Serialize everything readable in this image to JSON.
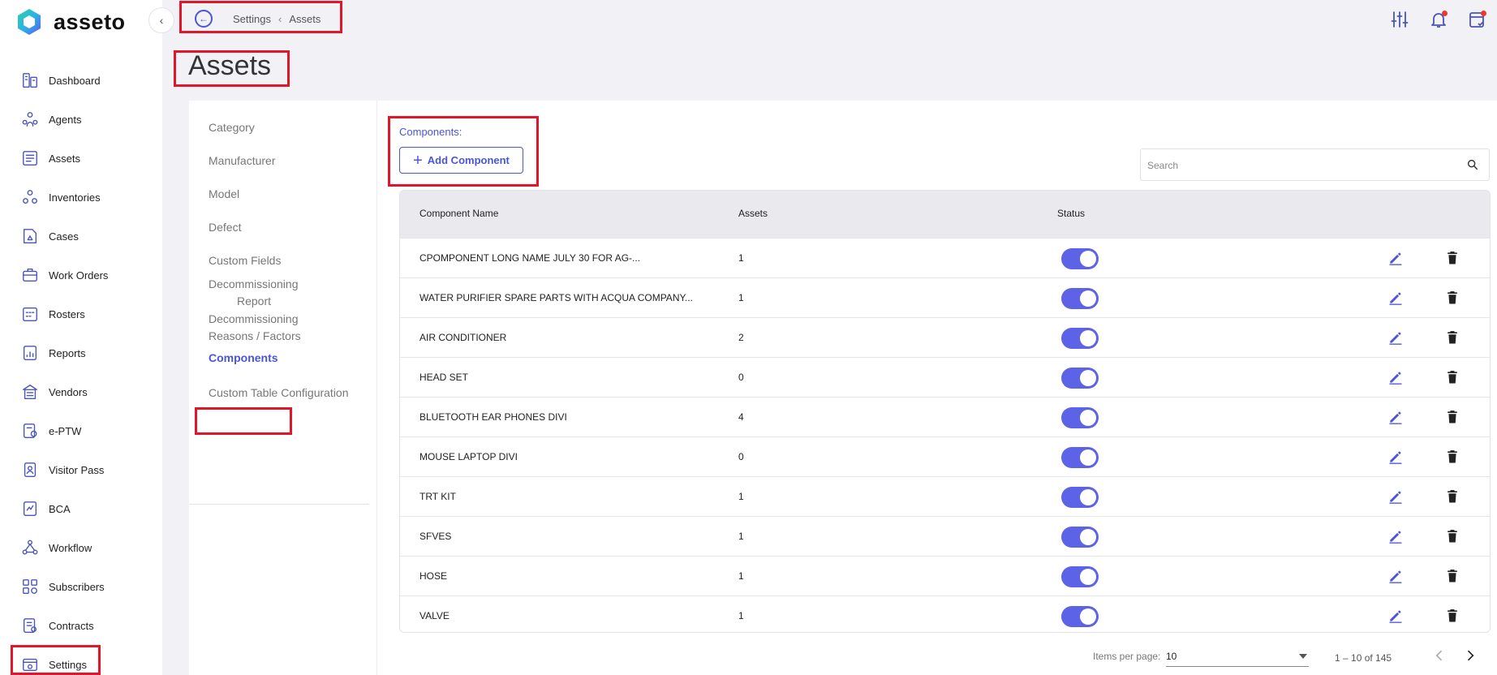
{
  "app": {
    "name": "asseto"
  },
  "sidebar": {
    "items": [
      {
        "label": "Dashboard",
        "icon": "dashboard-icon"
      },
      {
        "label": "Agents",
        "icon": "agents-icon"
      },
      {
        "label": "Assets",
        "icon": "assets-icon"
      },
      {
        "label": "Inventories",
        "icon": "inventories-icon"
      },
      {
        "label": "Cases",
        "icon": "cases-icon"
      },
      {
        "label": "Work Orders",
        "icon": "work-orders-icon"
      },
      {
        "label": "Rosters",
        "icon": "rosters-icon"
      },
      {
        "label": "Reports",
        "icon": "reports-icon"
      },
      {
        "label": "Vendors",
        "icon": "vendors-icon"
      },
      {
        "label": "e-PTW",
        "icon": "eptw-icon"
      },
      {
        "label": "Visitor Pass",
        "icon": "visitor-pass-icon"
      },
      {
        "label": "BCA",
        "icon": "bca-icon"
      },
      {
        "label": "Workflow",
        "icon": "workflow-icon"
      },
      {
        "label": "Subscribers",
        "icon": "subscribers-icon"
      },
      {
        "label": "Contracts",
        "icon": "contracts-icon"
      },
      {
        "label": "Settings",
        "icon": "settings-icon"
      }
    ]
  },
  "breadcrumb": {
    "parent": "Settings",
    "current": "Assets"
  },
  "page": {
    "title": "Assets"
  },
  "subnav": {
    "items": [
      {
        "label": "Category"
      },
      {
        "label": "Manufacturer"
      },
      {
        "label": "Model"
      },
      {
        "label": "Defect"
      },
      {
        "label": "Custom Fields"
      },
      {
        "label": "Decommissioning",
        "label2": "Report"
      },
      {
        "label": "Decommissioning",
        "label2": "Reasons / Factors"
      },
      {
        "label": "Components"
      },
      {
        "label": "Custom Table Configuration"
      }
    ],
    "active": "Components"
  },
  "components": {
    "section_label": "Components:",
    "add_button": "Add Component",
    "search_placeholder": "Search"
  },
  "table": {
    "headers": {
      "name": "Component Name",
      "assets": "Assets",
      "status": "Status"
    },
    "rows": [
      {
        "name": "CPOMPONENT LONG NAME JULY 30 FOR AG-...",
        "assets": "1",
        "status": true
      },
      {
        "name": "WATER PURIFIER SPARE PARTS WITH ACQUA COMPANY...",
        "assets": "1",
        "status": true
      },
      {
        "name": "AIR CONDITIONER",
        "assets": "2",
        "status": true
      },
      {
        "name": "HEAD SET",
        "assets": "0",
        "status": true
      },
      {
        "name": "BLUETOOTH EAR PHONES DIVI",
        "assets": "4",
        "status": true
      },
      {
        "name": "MOUSE LAPTOP DIVI",
        "assets": "0",
        "status": true
      },
      {
        "name": "TRT KIT",
        "assets": "1",
        "status": true
      },
      {
        "name": "SFVES",
        "assets": "1",
        "status": true
      },
      {
        "name": "HOSE",
        "assets": "1",
        "status": true
      },
      {
        "name": "VALVE",
        "assets": "1",
        "status": true
      }
    ]
  },
  "pagination": {
    "items_per_page_label": "Items per page:",
    "items_per_page": "10",
    "range": "1 – 10 of 145"
  },
  "colors": {
    "accent": "#4a55d8",
    "toggle": "#5c63e6",
    "highlight": "#e3152b"
  }
}
